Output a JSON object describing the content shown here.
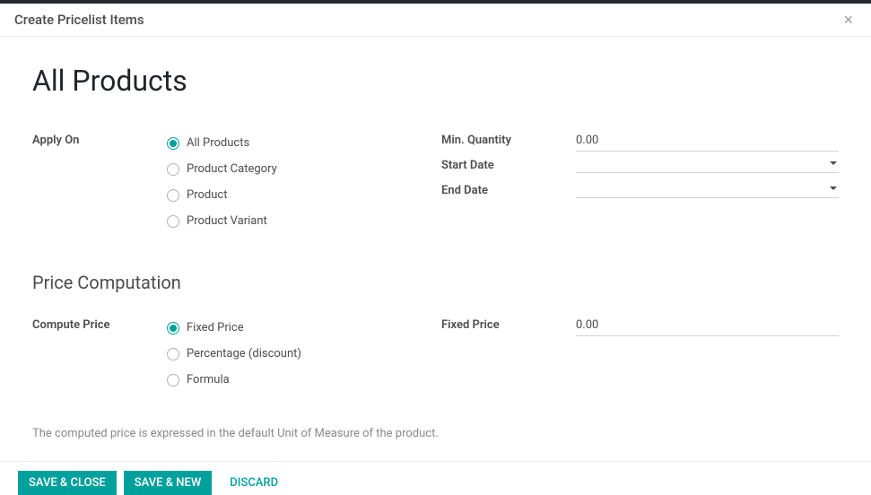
{
  "header": {
    "title": "Create Pricelist Items"
  },
  "main": {
    "title": "All Products"
  },
  "applyOn": {
    "label": "Apply On",
    "options": [
      {
        "label": "All Products",
        "selected": true
      },
      {
        "label": "Product Category",
        "selected": false
      },
      {
        "label": "Product",
        "selected": false
      },
      {
        "label": "Product Variant",
        "selected": false
      }
    ]
  },
  "minQuantity": {
    "label": "Min. Quantity",
    "value": "0.00"
  },
  "startDate": {
    "label": "Start Date",
    "value": ""
  },
  "endDate": {
    "label": "End Date",
    "value": ""
  },
  "priceComputation": {
    "title": "Price Computation"
  },
  "computePrice": {
    "label": "Compute Price",
    "options": [
      {
        "label": "Fixed Price",
        "selected": true
      },
      {
        "label": "Percentage (discount)",
        "selected": false
      },
      {
        "label": "Formula",
        "selected": false
      }
    ]
  },
  "fixedPrice": {
    "label": "Fixed Price",
    "value": "0.00"
  },
  "helper": "The computed price is expressed in the default Unit of Measure of the product.",
  "footer": {
    "saveClose": "Save & Close",
    "saveNew": "Save & New",
    "discard": "Discard"
  }
}
